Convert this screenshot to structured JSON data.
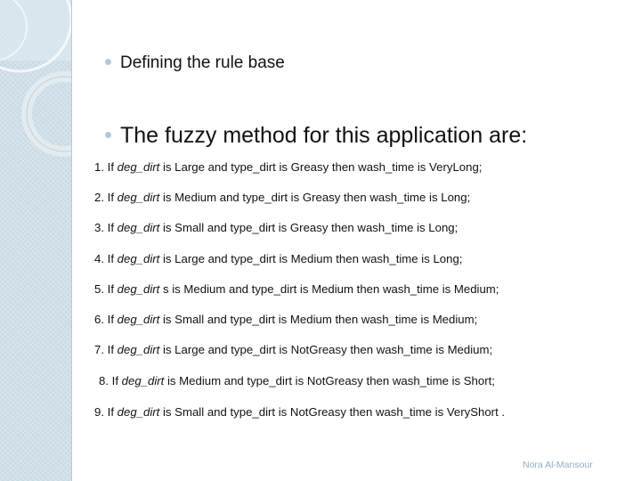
{
  "bullets": [
    "Defining the rule base",
    "The fuzzy method for this application are:"
  ],
  "rules": [
    {
      "prefix": "1. If ",
      "var": "deg_dirt",
      "rest": " is Large and type_dirt is Greasy then wash_time is VeryLong;"
    },
    {
      "prefix": "2. If ",
      "var": "deg_dirt",
      "rest": "  is Medium and type_dirt is Greasy then wash_time is Long;"
    },
    {
      "prefix": "3. If ",
      "var": "deg_dirt",
      "rest": " is Small and type_dirt is Greasy then wash_time is Long;"
    },
    {
      "prefix": "4. If ",
      "var": "deg_dirt",
      "rest": " is Large and type_dirt is Medium then wash_time is Long;"
    },
    {
      "prefix": "5. If ",
      "var": "deg_dirt",
      "rest": " s is Medium and type_dirt is Medium then wash_time is Medium;"
    },
    {
      "prefix": "6. If ",
      "var": "deg_dirt",
      "rest": " is Small and type_dirt is Medium then wash_time is Medium;"
    },
    {
      "prefix": "7. If ",
      "var": "deg_dirt",
      "rest": "  is Large and type_dirt is NotGreasy then wash_time is Medium;"
    },
    {
      "prefix": "8. If ",
      "var": "deg_dirt",
      "rest": " is Medium and type_dirt is NotGreasy then wash_time is Short;"
    },
    {
      "prefix": "9. If ",
      "var": "deg_dirt",
      "rest": " is Small and type_dirt is NotGreasy then wash_time is VeryShort ."
    }
  ],
  "footer": "Nora Al-Mansour",
  "colors": {
    "side_panel": "#c9dbe5",
    "bullet": "#b5c7d2",
    "footer_text": "#8fb0c2"
  }
}
